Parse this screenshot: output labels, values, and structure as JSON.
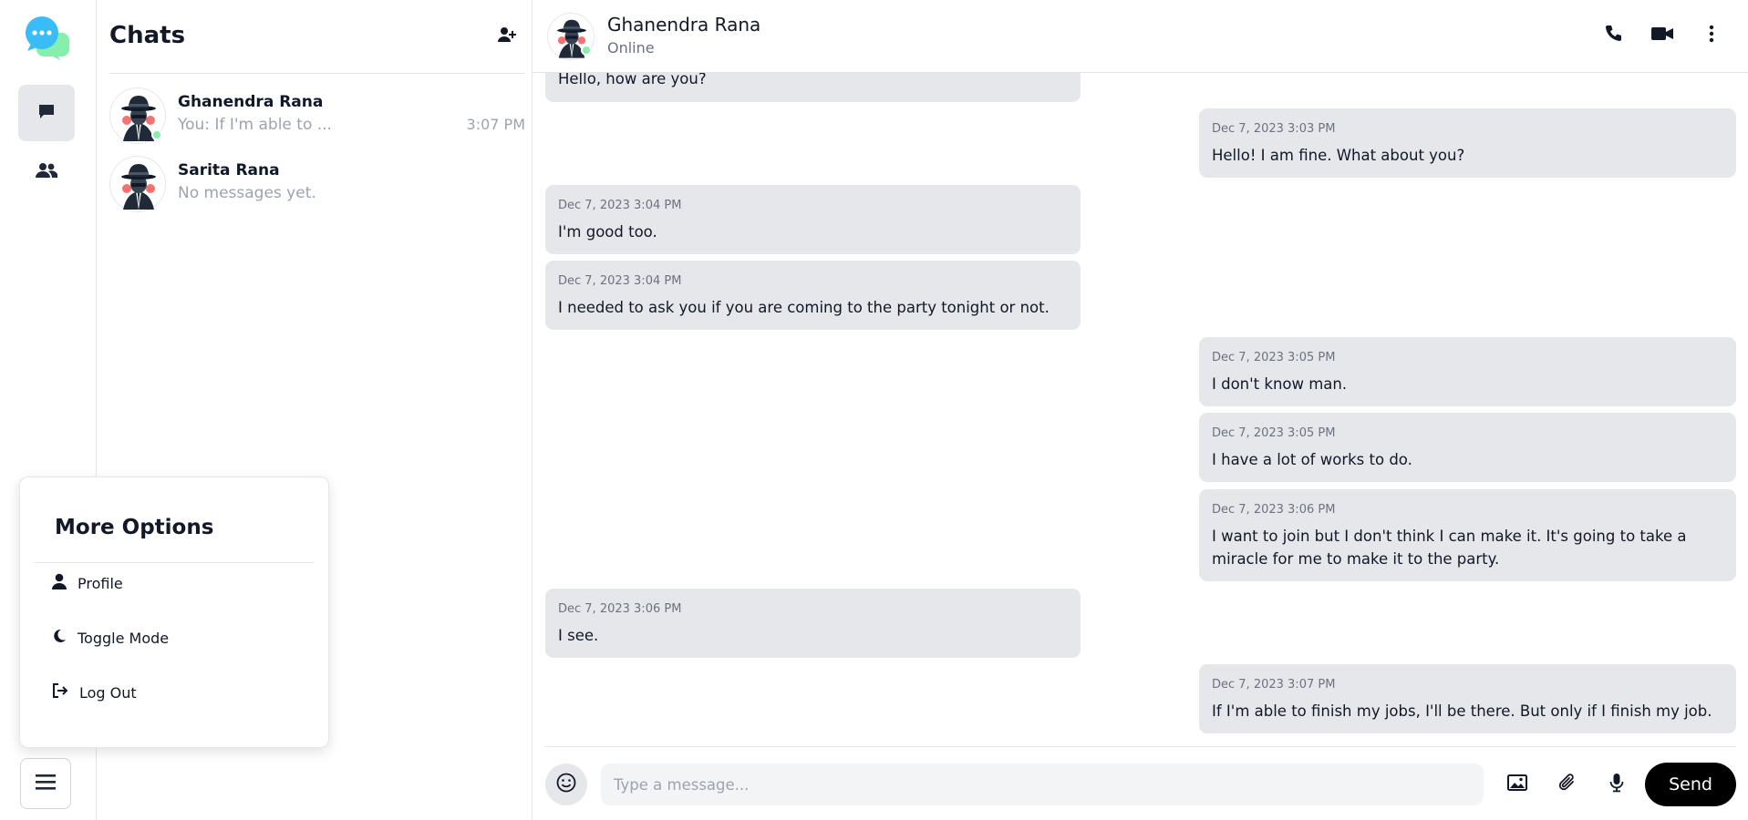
{
  "app": {
    "icons": {
      "logo": "chat-bubbles-logo",
      "chats": "message-icon",
      "contacts": "users-icon",
      "menu": "hamburger-menu-icon"
    },
    "accent_color": "#38bdf8"
  },
  "chat_list": {
    "title": "Chats",
    "add_icon": "user-plus-icon",
    "items": [
      {
        "name": "Ghanendra Rana",
        "preview": "You: If I'm able to ...",
        "time": "3:07 PM",
        "online": true
      },
      {
        "name": "Sarita Rana",
        "preview": "No messages yet.",
        "time": "",
        "online": false
      }
    ]
  },
  "more_options": {
    "title": "More Options",
    "items": [
      {
        "label": "Profile",
        "icon": "user-icon"
      },
      {
        "label": "Toggle Mode",
        "icon": "moon-icon"
      },
      {
        "label": "Log Out",
        "icon": "logout-icon"
      }
    ]
  },
  "conversation": {
    "name": "Ghanendra Rana",
    "status": "Online",
    "header_icons": [
      "phone-icon",
      "video-icon",
      "more-vertical-icon"
    ],
    "messages": [
      {
        "direction": "in",
        "time": "",
        "text": "Hello, how are you?"
      },
      {
        "direction": "out",
        "time": "Dec 7, 2023 3:03 PM",
        "text": "Hello! I am fine. What about you?"
      },
      {
        "direction": "in",
        "time": "Dec 7, 2023 3:04 PM",
        "text": "I'm good too."
      },
      {
        "direction": "in",
        "time": "Dec 7, 2023 3:04 PM",
        "text": "I needed to ask you if you are coming to the party tonight or not."
      },
      {
        "direction": "out",
        "time": "Dec 7, 2023 3:05 PM",
        "text": "I don't know man."
      },
      {
        "direction": "out",
        "time": "Dec 7, 2023 3:05 PM",
        "text": "I have a lot of works to do."
      },
      {
        "direction": "out",
        "time": "Dec 7, 2023 3:06 PM",
        "text": "I want to join but I don't think I can make it. It's going to take a miracle for me to make it to the party."
      },
      {
        "direction": "in",
        "time": "Dec 7, 2023 3:06 PM",
        "text": "I see."
      },
      {
        "direction": "out",
        "time": "Dec 7, 2023 3:07 PM",
        "text": "If I'm able to finish my jobs, I'll be there. But only if I finish my job."
      }
    ]
  },
  "composer": {
    "placeholder": "Type a message...",
    "send_label": "Send",
    "icons": [
      "smile-icon",
      "image-icon",
      "paperclip-icon",
      "microphone-icon"
    ]
  }
}
